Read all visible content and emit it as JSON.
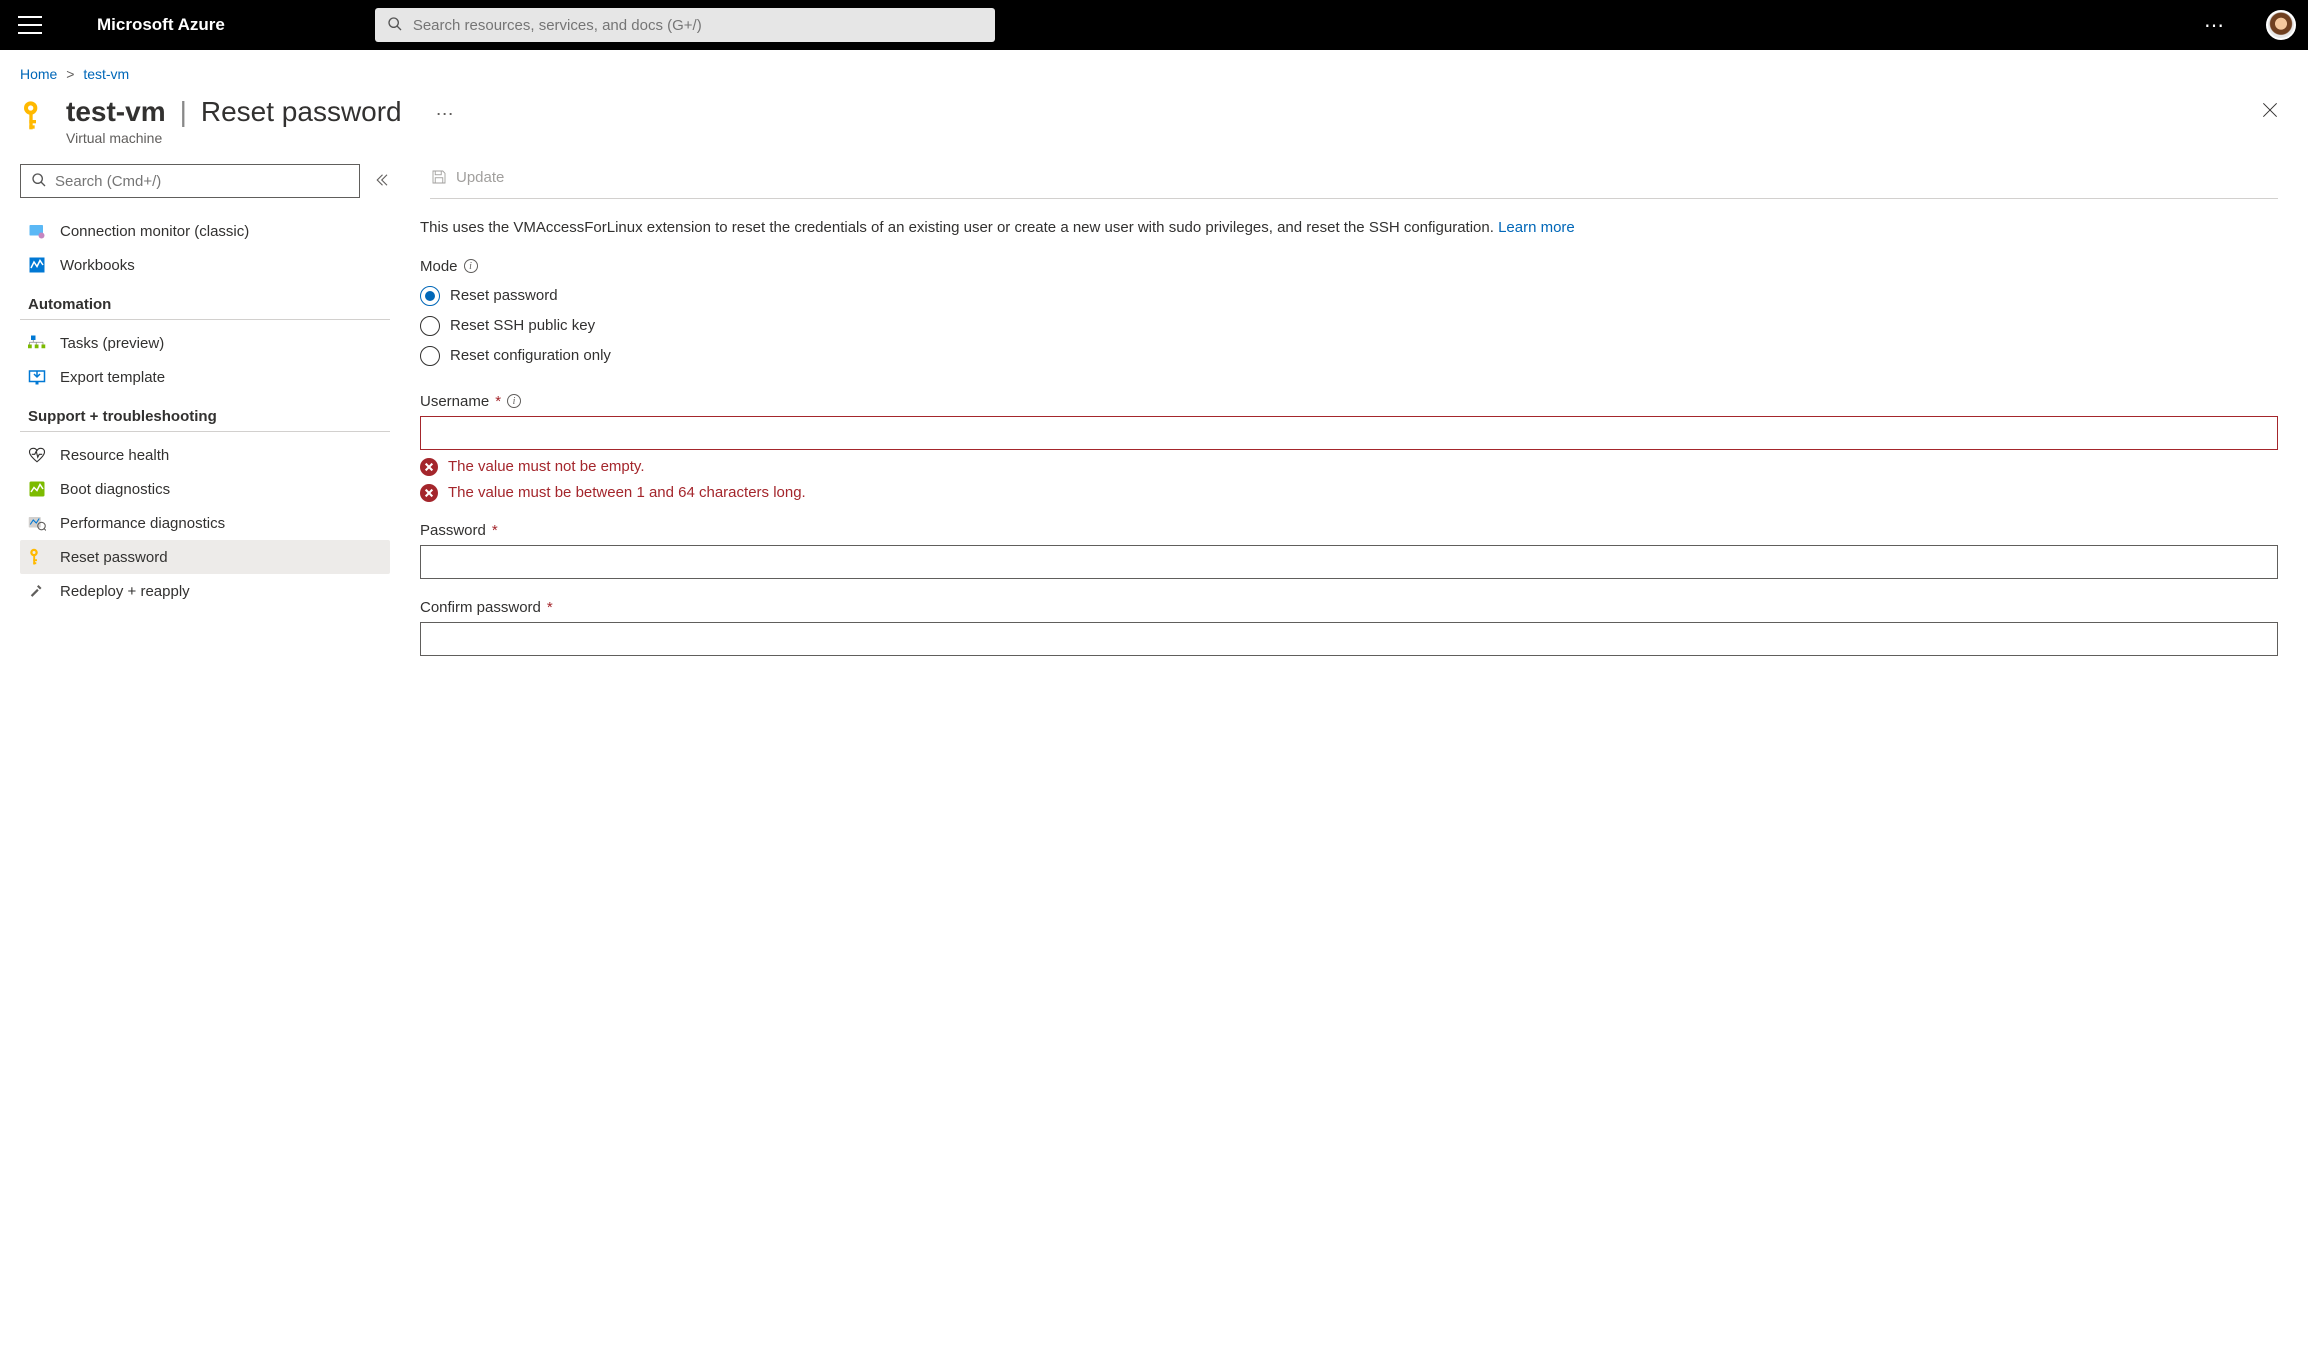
{
  "topbar": {
    "brand": "Microsoft Azure",
    "search_placeholder": "Search resources, services, and docs (G+/)"
  },
  "breadcrumb": {
    "items": [
      "Home",
      "test-vm"
    ]
  },
  "header": {
    "title_resource": "test-vm",
    "title_blade": "Reset password",
    "subtitle": "Virtual machine"
  },
  "sidebar": {
    "search_placeholder": "Search (Cmd+/)",
    "items_top": [
      {
        "label": "Connection monitor (classic)",
        "icon": "monitor-icon"
      },
      {
        "label": "Workbooks",
        "icon": "workbooks-icon"
      }
    ],
    "groups": [
      {
        "title": "Automation",
        "items": [
          {
            "label": "Tasks (preview)",
            "icon": "tasks-icon"
          },
          {
            "label": "Export template",
            "icon": "export-icon"
          }
        ]
      },
      {
        "title": "Support + troubleshooting",
        "items": [
          {
            "label": "Resource health",
            "icon": "heart-icon"
          },
          {
            "label": "Boot diagnostics",
            "icon": "boot-icon"
          },
          {
            "label": "Performance diagnostics",
            "icon": "perf-icon"
          },
          {
            "label": "Reset password",
            "icon": "key-icon",
            "active": true
          },
          {
            "label": "Redeploy + reapply",
            "icon": "hammer-icon"
          }
        ]
      }
    ]
  },
  "content": {
    "toolbar": {
      "update_label": "Update"
    },
    "description_text": "This uses the VMAccessForLinux extension to reset the credentials of an existing user or create a new user with sudo privileges, and reset the SSH configuration. ",
    "learn_more": "Learn more",
    "mode": {
      "label": "Mode",
      "options": [
        "Reset password",
        "Reset SSH public key",
        "Reset configuration only"
      ],
      "selected": 0
    },
    "username": {
      "label": "Username",
      "value": "",
      "errors": [
        "The value must not be empty.",
        "The value must be between 1 and 64 characters long."
      ]
    },
    "password": {
      "label": "Password",
      "value": ""
    },
    "confirm_password": {
      "label": "Confirm password",
      "value": ""
    }
  }
}
